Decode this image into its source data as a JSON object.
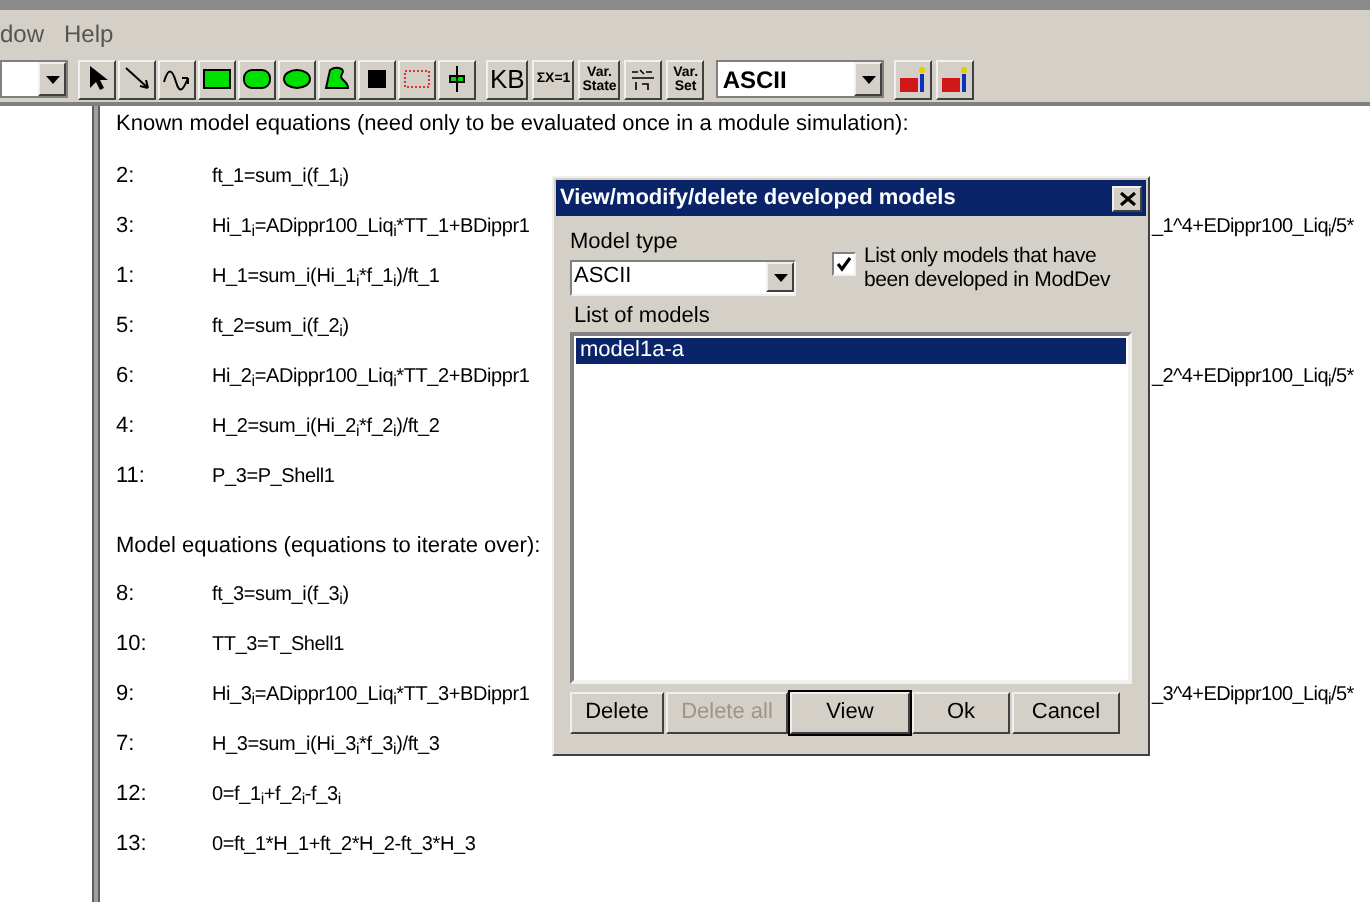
{
  "menu": [
    "dow",
    "Help"
  ],
  "toolbar": {
    "buttons": [
      {
        "kind": "text",
        "label": "KB"
      },
      {
        "kind": "text",
        "label": "ΣX=1"
      },
      {
        "kind": "text",
        "label": "Var. State"
      },
      {
        "kind": "formula"
      },
      {
        "kind": "text",
        "label": "Var. Set"
      }
    ],
    "format_combo": {
      "value": "ASCII"
    }
  },
  "document": {
    "sections": [
      {
        "heading": "Known model equations (need only to be evaluated once in a module simulation):",
        "equations": [
          {
            "number": "2:",
            "text": "ft_1=sum_i(f_1$_{i}$)"
          },
          {
            "number": "3:",
            "text": "Hi_1$_{i}$=ADippr100_Liq$_{i}$*TT_1+BDippr1",
            "continuation": "_1^4+EDippr100_Liq$_{i}$/5*"
          },
          {
            "number": "1:",
            "text": "H_1=sum_i(Hi_1$_{i}$*f_1$_{i}$)/ft_1"
          },
          {
            "number": "5:",
            "text": "ft_2=sum_i(f_2$_{i}$)"
          },
          {
            "number": "6:",
            "text": "Hi_2$_{i}$=ADippr100_Liq$_{i}$*TT_2+BDippr1",
            "continuation": "_2^4+EDippr100_Liq$_{i}$/5*"
          },
          {
            "number": "4:",
            "text": "H_2=sum_i(Hi_2$_{i}$*f_2$_{i}$)/ft_2"
          },
          {
            "number": "11:",
            "text": "P_3=P_Shell1"
          }
        ]
      },
      {
        "heading": "Model equations (equations to iterate over):",
        "equations": [
          {
            "number": "8:",
            "text": "ft_3=sum_i(f_3$_{i}$)"
          },
          {
            "number": "10:",
            "text": "TT_3=T_Shell1"
          },
          {
            "number": "9:",
            "text": "Hi_3$_{i}$=ADippr100_Liq$_{i}$*TT_3+BDippr1",
            "continuation": "_3^4+EDippr100_Liq$_{i}$/5*"
          },
          {
            "number": "7:",
            "text": "H_3=sum_i(Hi_3$_{i}$*f_3$_{i}$)/ft_3"
          },
          {
            "number": "12:",
            "text": "0=f_1$_{i}$+f_2$_{i}$-f_3$_{i}$"
          },
          {
            "number": "13:",
            "text": "0=ft_1*H_1+ft_2*H_2-ft_3*H_3"
          }
        ]
      }
    ]
  },
  "dialog": {
    "title": "View/modify/delete developed models",
    "model_type_label": "Model type",
    "model_type_value": "ASCII",
    "checkbox": {
      "label": "List only models that have been developed in ModDev",
      "checked": true
    },
    "list_label": "List of models",
    "models": [
      {
        "label": "model1a-a",
        "selected": true
      }
    ],
    "buttons": [
      {
        "label": "Delete",
        "disabled": false,
        "default": false
      },
      {
        "label": "Delete all",
        "disabled": true,
        "default": false
      },
      {
        "label": "View",
        "disabled": false,
        "default": true
      },
      {
        "label": "Ok",
        "disabled": false,
        "default": false
      },
      {
        "label": "Cancel",
        "disabled": false,
        "default": false
      }
    ]
  }
}
